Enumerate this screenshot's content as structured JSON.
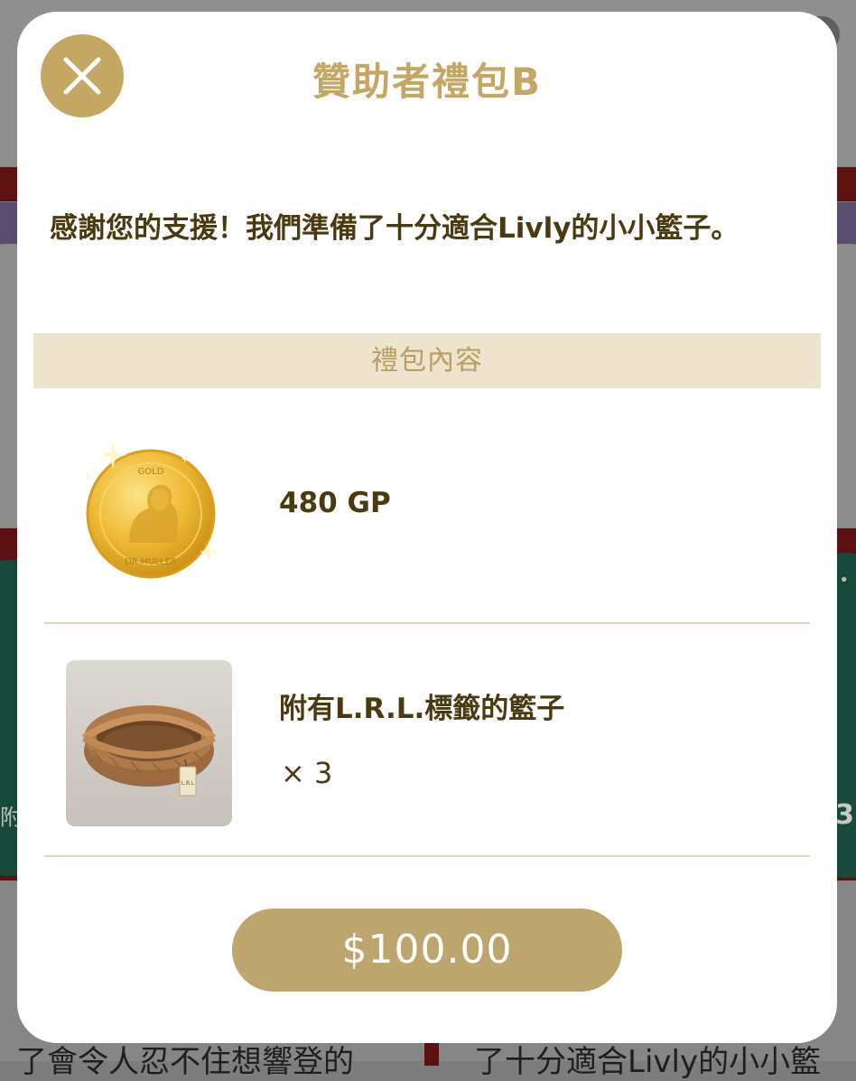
{
  "background": {
    "bottom_left_text": "了會令人忍不住想響登的",
    "bottom_right_text": "了十分適合Livly的小小籃",
    "edge_right_text": "3",
    "edge_left_text": "附",
    "dots": "• • •"
  },
  "modal": {
    "title": "贊助者禮包B",
    "close_icon": "close-icon",
    "message": "感謝您的支援！我們準備了十分適合Livly的小小籃子。",
    "section_header": "禮包內容",
    "items": [
      {
        "icon": "gold-coin-icon",
        "name": "480 GP",
        "coin_text_top": "GOLD",
        "coin_text_bottom": "DR.MULLER"
      },
      {
        "icon": "basket-icon",
        "name": "附有L.R.L.標籤的籃子",
        "quantity": "× 3",
        "tag_text": "L.R.L"
      }
    ],
    "price_label": "$100.00"
  },
  "colors": {
    "accent_gold": "#c3a763",
    "button_gold": "#bda56e",
    "header_beige": "#eee4cd",
    "text_brown": "#4a3a10",
    "overlay_gray": "#7d7d7d"
  }
}
